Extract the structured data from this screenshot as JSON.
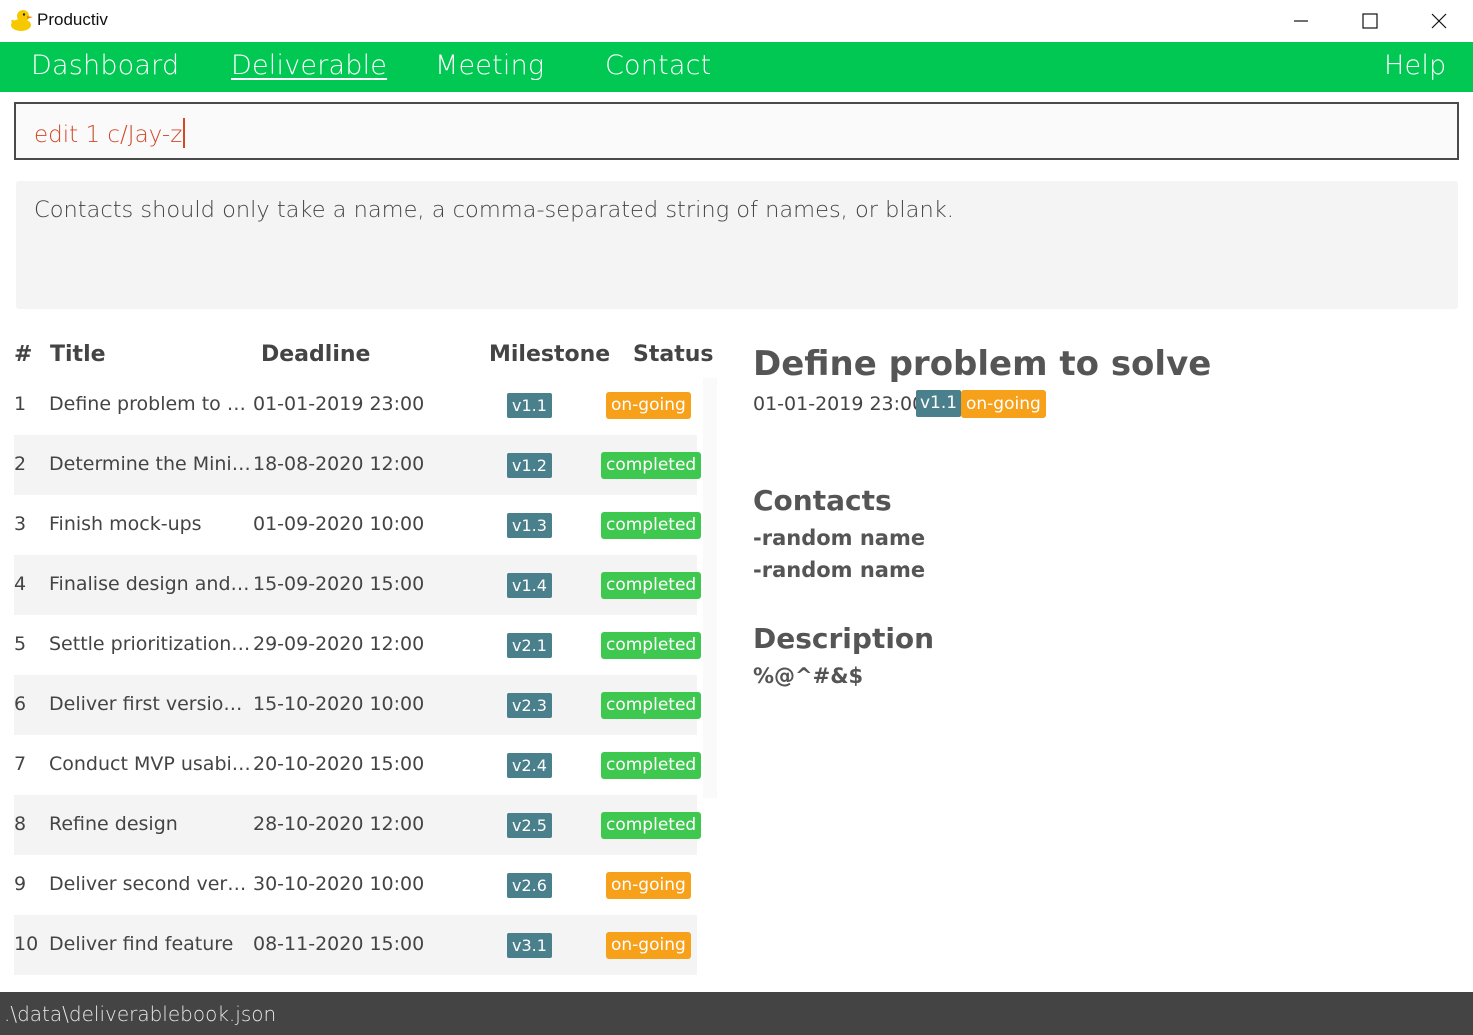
{
  "window": {
    "title": "Productiv",
    "app_icon": "rubber-duck-icon",
    "controls": [
      "minimize-icon",
      "maximize-icon",
      "close-icon"
    ]
  },
  "menu": {
    "items": [
      {
        "label": "Dashboard",
        "active": false
      },
      {
        "label": "Deliverable",
        "active": true
      },
      {
        "label": "Meeting",
        "active": false
      },
      {
        "label": "Contact",
        "active": false
      }
    ],
    "help": "Help"
  },
  "command": {
    "value": "edit 1 c/Jay-z"
  },
  "result": {
    "message": "Contacts should only take a name, a comma-separated string of names, or blank."
  },
  "list": {
    "headers": {
      "index": "#",
      "title": "Title",
      "deadline": "Deadline",
      "milestone": "Milestone",
      "status": "Status"
    },
    "rows": [
      {
        "index": "1",
        "title": "Define problem to sol...",
        "deadline": "01-01-2019 23:00",
        "milestone": "v1.1",
        "status": "on-going"
      },
      {
        "index": "2",
        "title": "Determine the Minim...",
        "deadline": "18-08-2020 12:00",
        "milestone": "v1.2",
        "status": "completed"
      },
      {
        "index": "3",
        "title": "Finish mock-ups",
        "deadline": "01-09-2020 10:00",
        "milestone": "v1.3",
        "status": "completed"
      },
      {
        "index": "4",
        "title": "Finalise design and pl...",
        "deadline": "15-09-2020 15:00",
        "milestone": "v1.4",
        "status": "completed"
      },
      {
        "index": "5",
        "title": "Settle prioritization of...",
        "deadline": "29-09-2020 12:00",
        "milestone": "v2.1",
        "status": "completed"
      },
      {
        "index": "6",
        "title": "Deliver first version of...",
        "deadline": "15-10-2020 10:00",
        "milestone": "v2.3",
        "status": "completed"
      },
      {
        "index": "7",
        "title": "Conduct MVP usabilit...",
        "deadline": "20-10-2020 15:00",
        "milestone": "v2.4",
        "status": "completed"
      },
      {
        "index": "8",
        "title": "Refine design",
        "deadline": "28-10-2020 12:00",
        "milestone": "v2.5",
        "status": "completed"
      },
      {
        "index": "9",
        "title": "Deliver second versio...",
        "deadline": "30-10-2020 10:00",
        "milestone": "v2.6",
        "status": "on-going"
      },
      {
        "index": "10",
        "title": "Deliver find feature",
        "deadline": "08-11-2020 15:00",
        "milestone": "v3.1",
        "status": "on-going"
      }
    ]
  },
  "detail": {
    "title": "Define problem to solve",
    "deadline": "01-01-2019 23:00",
    "milestone": "v1.1",
    "status": "on-going",
    "contacts_heading": "Contacts",
    "contacts": [
      "-random name",
      "-random name"
    ],
    "description_heading": "Description",
    "description": "%@^#&$"
  },
  "statusbar": {
    "path": ".\\data\\deliverablebook.json"
  },
  "colors": {
    "menubar": "#00c853",
    "milestone_badge": "#4a7f8c",
    "ongoing_badge": "#f7a01a",
    "completed_badge": "#3fc850",
    "command_text": "#d04a2a",
    "statusbar": "#444444"
  }
}
